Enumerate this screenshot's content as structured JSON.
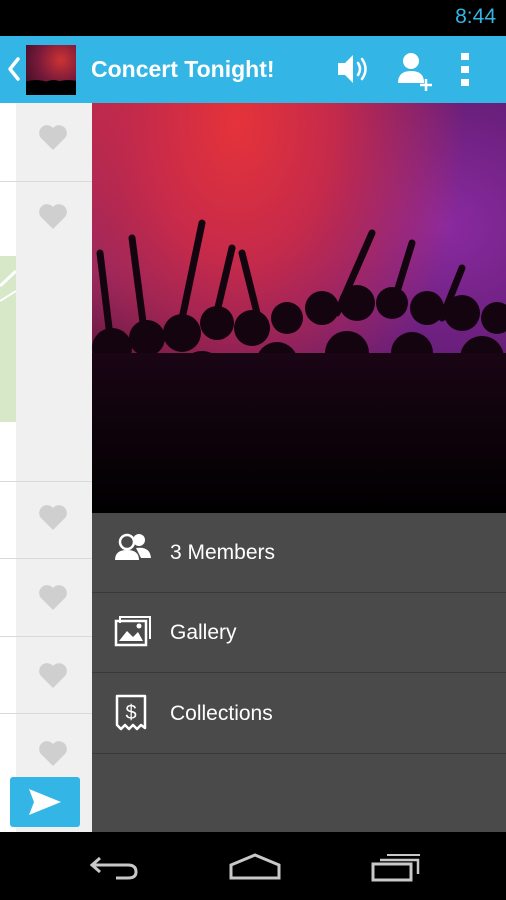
{
  "status_bar": {
    "time": "8:44"
  },
  "action_bar": {
    "title": "Concert Tonight!",
    "icons": [
      "back-icon",
      "volume-icon",
      "add-user-icon",
      "overflow-menu-icon"
    ]
  },
  "drawer": {
    "menu": [
      {
        "label": "3 Members",
        "icon": "members-icon"
      },
      {
        "label": "Gallery",
        "icon": "gallery-icon"
      },
      {
        "label": "Collections",
        "icon": "collections-icon"
      }
    ]
  },
  "colors": {
    "accent": "#33b5e5",
    "drawer_bg": "#4a4a4a",
    "heart": "#cfcfcf"
  }
}
